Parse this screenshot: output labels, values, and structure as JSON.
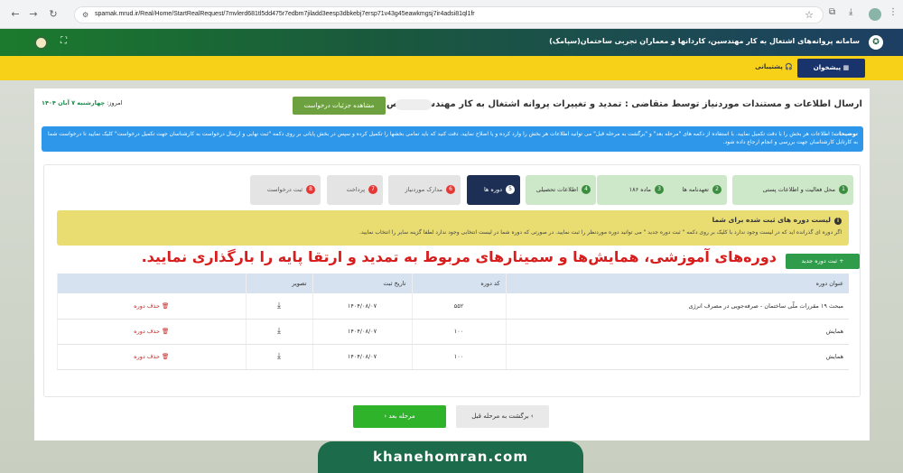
{
  "browser": {
    "url": "spamak.mrud.ir/Real/Home/StartRealRequest/7mvlerd681tl5dd475r7edbm7jiladd3eesp3dbkebj7ersp71v43g45eawkmgsj7ir4adsi81ql1fr"
  },
  "header": {
    "system_title": "سامانه پروانه‌های اشتغال به کار مهندسین، کاردانها و معماران تجربی ساختمان(سپامک)"
  },
  "nav": {
    "dashboard": "پیشخوان",
    "support": "پشتیبانی"
  },
  "page": {
    "title": "ارسال اطلاعات و مستندات موردنیاز توسط متقاضی : تمدید و تغییرات پروانه اشتغال به کار مهندسی شخص حقیقی",
    "details_button": "مشاهده جزئیات درخواست",
    "today_label": "امروز:",
    "today_value": "چهارشنبه ۷ آبان ۱۴۰۴",
    "info_label": "توضیحات:",
    "info_text": "اطلاعات هر بخش را با دقت تکمیل نمایید. با استفاده از دکمه های \"مرحله بعد\" و \"برگشت به مرحله قبل\" می توانید اطلاعات هر بخش را وارد کرده و یا اصلاح نمایید. دقت کنید که باید تمامی بخشها را تکمیل کرده و سپس در بخش پایانی بر روی دکمه \"ثبت نهایی و ارسال درخواست به کارشناسان جهت تکمیل درخواست\" کلیک نمایید تا درخواست شما به کارتابل کارشناسان جهت بررسی و انجام ارجاع داده شود."
  },
  "steps": [
    {
      "num": "1",
      "label": "محل فعالیت و اطلاعات پستی",
      "state": "done"
    },
    {
      "num": "2",
      "label": "تعهدنامه ها",
      "state": "done"
    },
    {
      "num": "3",
      "label": "ماده ۱۸۶",
      "state": "done"
    },
    {
      "num": "4",
      "label": "اطلاعات تحصیلی",
      "state": "done"
    },
    {
      "num": "5",
      "label": "دوره ها",
      "state": "active"
    },
    {
      "num": "6",
      "label": "مدارک موردنیاز",
      "state": "todo"
    },
    {
      "num": "7",
      "label": "پرداخت",
      "state": "todo"
    },
    {
      "num": "8",
      "label": "ثبت درخواست",
      "state": "todo"
    }
  ],
  "warning": {
    "title": "لیست دوره های ثبت شده برای شما",
    "text": "اگر دوره ای گذرانده اید که در لیست وجود ندارد با کلیک بر روی دکمه \" ثبت دوره جدید \" می توانید دوره موردنظر را ثبت نمایید. در صورتی که دوره شما در لیست انتخابی وجود ندارد لطفا گزینه سایر را انتخاب نمایید."
  },
  "add_course_button": "ثبت دوره جدید",
  "headline": "دوره‌های آموزشی، همایش‌ها و سمینارهای مربوط به تمدید و ارتقا پایه را بارگذاری نمایید.",
  "table": {
    "headers": [
      "عنوان دوره",
      "کد دوره",
      "تاریخ ثبت",
      "تصویر",
      ""
    ],
    "rows": [
      {
        "title": "مبحث ۱۹ مقررات ملّی ساختمان - صرفه‌جویی در مصرف انرژی",
        "code": "۵۵۲",
        "date": "۱۴۰۴/۰۸/۰۷",
        "delete": "حذف دوره"
      },
      {
        "title": "همایش",
        "code": "۱۰۰",
        "date": "۱۴۰۴/۰۸/۰۷",
        "delete": "حذف دوره"
      },
      {
        "title": "همایش",
        "code": "۱۰۰",
        "date": "۱۴۰۴/۰۸/۰۷",
        "delete": "حذف دوره"
      }
    ]
  },
  "buttons": {
    "next": "مرحله بعد",
    "back": "برگشت به مرحله قبل"
  },
  "watermark": "khanehomran.com",
  "colors": {
    "header_green": "#1a5a3c",
    "nav_yellow": "#f7d118",
    "dashboard_blue": "#19346d",
    "info_blue": "#2e97ea",
    "step_done": "#cde8c8",
    "step_active": "#1e2f55",
    "headline_red": "#d81d1d",
    "next_green": "#2fb32a"
  }
}
